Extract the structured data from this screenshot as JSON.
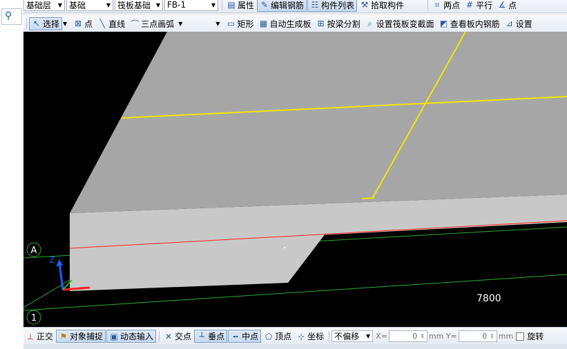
{
  "toolbar_top": {
    "floor": "基础层",
    "category": "基础",
    "type": "筏板基础",
    "component": "FB-1",
    "property_label": "属性",
    "edit_rebar_label": "编辑钢筋",
    "component_list_label": "构件列表",
    "pick_component_label": "拾取构件",
    "two_points_label": "两点",
    "parallel_label": "平行",
    "point_angle_label": "点"
  },
  "toolbar_draw": {
    "select_label": "选择",
    "point_label": "点",
    "line_label": "直线",
    "arc_label": "三点画弧",
    "rect_label": "矩形",
    "auto_generate_label": "自动生成板",
    "split_by_beam_label": "按梁分割",
    "set_section_label": "设置筏板变截面",
    "view_rebar_label": "查看板内钢筋",
    "settings_label": "设置"
  },
  "viewport": {
    "axis_a": "A",
    "axis_1": "1",
    "axis_z": "Z",
    "dimension": "7800",
    "colors": {
      "background": "#000000",
      "slab_top": "#a6a6a6",
      "slab_side": "#c8c8c8",
      "grid_yellow": "#f2e600",
      "axis_red": "#ff2020",
      "axis_green": "#2fae2f"
    }
  },
  "status_bar": {
    "ortho_label": "正交",
    "snap_label": "对象捕捉",
    "dynamic_input_label": "动态输入",
    "intersection_label": "交点",
    "perpendicular_label": "垂点",
    "midpoint_label": "中点",
    "vertex_label": "顶点",
    "coordinate_label": "坐标",
    "offset_value": "不偏移",
    "x_label": "X=",
    "x_value": "0",
    "y_label": "mm Y=",
    "y_value": "0",
    "unit_label": "mm",
    "rotate_label": "旋转"
  }
}
